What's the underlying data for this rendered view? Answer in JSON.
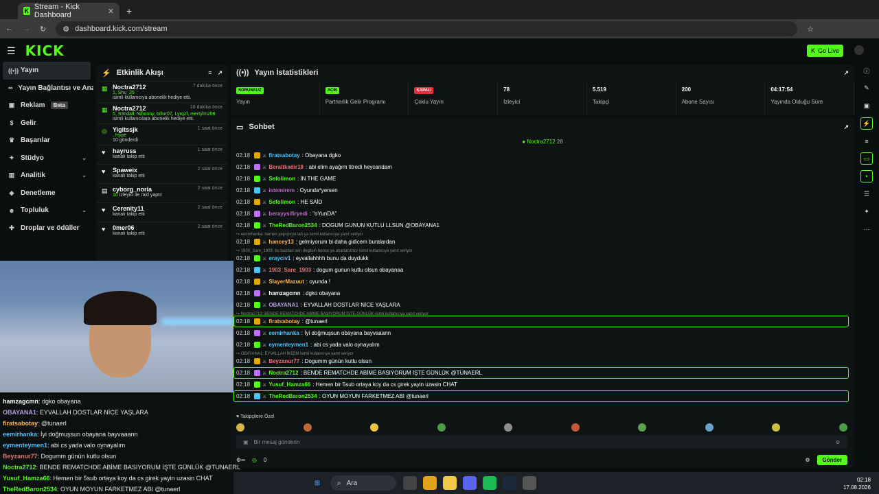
{
  "browser": {
    "tab_title": "Stream - Kick Dashboard",
    "url": "dashboard.kick.com/stream"
  },
  "header": {
    "logo": "KICK",
    "go_live": "Go Live"
  },
  "nav": [
    {
      "label": "Yayın",
      "icon": "broadcast-icon",
      "active": true
    },
    {
      "label": "Yayın Bağlantısı ve Anahtarı",
      "icon": "link-icon"
    },
    {
      "label": "Reklam",
      "icon": "ad-icon",
      "badge": "Beta"
    },
    {
      "label": "Gelir",
      "icon": "money-icon"
    },
    {
      "label": "Başarılar",
      "icon": "trophy-icon"
    },
    {
      "label": "Stüdyo",
      "icon": "studio-icon",
      "chevron": true
    },
    {
      "label": "Analitik",
      "icon": "chart-icon",
      "chevron": true
    },
    {
      "label": "Denetleme",
      "icon": "shield-icon"
    },
    {
      "label": "Topluluk",
      "icon": "users-icon",
      "chevron": true
    },
    {
      "label": "Droplar ve ödüller",
      "icon": "gift-icon"
    }
  ],
  "activity": {
    "title": "Etkinlik Akışı",
    "items": [
      {
        "user": "Noctra2712",
        "time": "7 dakika önce",
        "l1": "1, Shu_25",
        "l2": " isimli kullanıcıya abonelik hediye etti.",
        "kind": "gift"
      },
      {
        "user": "Noctra2712",
        "time": "16 dakika önce",
        "l1": "5, S3ndall, Nihonny, billur07, Lyrqzf, mertylmz08",
        "l2": "isimli kullanıcılara abonelik hediye etti.",
        "kind": "gift"
      },
      {
        "user": "Yigitssjk",
        "time": "1 saat önce",
        "l1": ", Hype",
        "l2": "10 gönderdi",
        "kind": "kicks"
      },
      {
        "user": "hayruss",
        "time": "1 saat önce",
        "l1": "",
        "l2": "kanalı takip etti",
        "kind": "follow"
      },
      {
        "user": "Spaweix",
        "time": "2 saat önce",
        "l1": "",
        "l2": "kanalı takip etti",
        "kind": "follow"
      },
      {
        "user": "cyborg_noria",
        "time": "2 saat önce",
        "l1": "10",
        "l2": " izleyici ile raid yaptı!",
        "kind": "raid"
      },
      {
        "user": "Cerenity11",
        "time": "2 saat önce",
        "l1": "",
        "l2": "kanalı takip etti",
        "kind": "follow"
      },
      {
        "user": "0mer06",
        "time": "2 saat önce",
        "l1": "",
        "l2": "kanalı takip etti",
        "kind": "follow"
      }
    ]
  },
  "stats": {
    "title": "Yayın İstatistikleri",
    "items": [
      {
        "badge": "SORUNSUZ",
        "badge_color": "#53fc18",
        "label": "Yayın"
      },
      {
        "badge": "AÇIK",
        "badge_color": "#53fc18",
        "label": "Partnerlik Gelir Programı"
      },
      {
        "badge": "KAPALI",
        "badge_color": "#e0303a",
        "label": "Çoklu Yayın"
      },
      {
        "value": "78",
        "label": "İzleyici"
      },
      {
        "value": "5.519",
        "label": "Takipçi"
      },
      {
        "value": "200",
        "label": "Abone Sayısı"
      },
      {
        "value": "04:17:54",
        "label": "Yayında Olduğu Süre"
      }
    ]
  },
  "chat": {
    "title": "Sohbet",
    "pinned_user": "Noctra2712",
    "pinned_count": "28",
    "messages": [
      {
        "time": "02:18",
        "user": "firatsabotay",
        "color": "#4fc3f7",
        "text": ": Obayana dgko"
      },
      {
        "time": "02:18",
        "user": "Beraltkadir18",
        "color": "#e57373",
        "text": ": abi elim ayağım titredi heycandam"
      },
      {
        "time": "02:18",
        "user": "Sefolimon",
        "color": "#53fc18",
        "text": ": İN THE GAME"
      },
      {
        "time": "02:18",
        "user": "istemirem",
        "color": "#ba68c8",
        "text": ": Oyunda*yersen"
      },
      {
        "time": "02:18",
        "user": "Sefolimon",
        "color": "#53fc18",
        "text": ": HE SAİD"
      },
      {
        "time": "02:18",
        "user": "berayysifiryedi",
        "color": "#ba68c8",
        "text": ": \"oYunDA\""
      },
      {
        "time": "02:18",
        "user": "TheRedBaron2534",
        "color": "#53fc18",
        "text": ": DOGUM GUNUN KUTLU LLSUN @OBAYANA1"
      },
      {
        "reply": "eemirhanka: hemen yapıştıryo lafı ya isimli kullanıcıya yanıt veriyor"
      },
      {
        "time": "02:18",
        "user": "hancey13",
        "color": "#ffb74d",
        "text": ": gelmiyorum bi daha gidicem buralardan"
      },
      {
        "reply": "1903_Sare_1903: bu bazılari sen degilsin bence ya ahahahzhzv isimli kullanıcıya yanıt veriyor"
      },
      {
        "time": "02:18",
        "user": "erayciv1",
        "color": "#4fc3f7",
        "text": ": eyvallahhhh bunu da duydukk"
      },
      {
        "time": "02:18",
        "user": "1903_Sare_1903",
        "color": "#e57373",
        "text": ": dogum gunun kutlu olsun obayanaa"
      },
      {
        "time": "02:18",
        "user": "SlayerMazuut",
        "color": "#ffb74d",
        "text": ": oyunda !"
      },
      {
        "time": "02:18",
        "user": "hamzagcmn",
        "color": "#ffffff",
        "text": ": dgko obayana"
      },
      {
        "time": "02:18",
        "user": "OBAYANA1",
        "color": "#b39ddb",
        "text": ": EYVALLAH DOSTLAR NİCE YAŞLARA"
      },
      {
        "reply": "Noctra2712: BENDE REMATCHDE ABİME BASIYORUM İŞTE GÜNLÜK isimli kullanıcıya yanıt veriyor"
      },
      {
        "time": "02:18",
        "user": "firatsabotay",
        "color": "#ffb74d",
        "text": ": @tunaerl"
      },
      {
        "time": "02:18",
        "user": "eemirhanka",
        "color": "#4fc3f7",
        "text": ": İyi doğmuşsun obayana bayvaaann"
      },
      {
        "time": "02:18",
        "user": "eymenteymen1",
        "color": "#4fc3f7",
        "text": ": abi cs yada valo oynayalım"
      },
      {
        "reply": "OBAYANA1: EYVALLAH İKİZİM isimli kullanıcıya yanıt veriyor"
      },
      {
        "time": "02:18",
        "user": "Beyzanur77",
        "color": "#e57373",
        "text": ": Dogumm günün kutlu olsun"
      },
      {
        "time": "02:18",
        "user": "Noctra2712",
        "color": "#53fc18",
        "text": ": BENDE REMATCHDE ABİME BASIYORUM İŞTE GÜNLÜK @TUNAERL"
      },
      {
        "time": "02:18",
        "user": "Yusuf_Hamza66",
        "color": "#53fc18",
        "text": ": Hemen bir 5sub ortaya koy da cs girek yayin uzasin CHAT"
      },
      {
        "time": "02:18",
        "user": "TheRedBaron2534",
        "color": "#53fc18",
        "text": ": OYUN MOYUN FARKETMEZ ABI @tunaerl"
      }
    ],
    "followers_only": "Takipçilere Özel",
    "placeholder": "Bir mesaj gönderin",
    "count": "0",
    "send": "Gönder"
  },
  "overlay": [
    {
      "user": "hamzagcmn",
      "color": "#ffffff",
      "text": ": dgko obayana"
    },
    {
      "user": "OBAYANA1",
      "color": "#b39ddb",
      "text": ": EYVALLAH DOSTLAR NİCE YAŞLARA"
    },
    {
      "user": "firatsabotay",
      "color": "#ffb74d",
      "text": ": @tunaerl"
    },
    {
      "user": "eemirhanka",
      "color": "#4fc3f7",
      "text": ": İyi doğmuşsun obayana bayvaaann"
    },
    {
      "user": "eymenteymen1",
      "color": "#4fc3f7",
      "text": ": abi cs yada valo oynayalım"
    },
    {
      "user": "Beyzanur77",
      "color": "#e57373",
      "text": ": Dogumm günün kutlu olsun"
    },
    {
      "user": "Noctra2712",
      "color": "#53fc18",
      "text": ": BENDE REMATCHDE ABİME BASIYORUM İŞTE GÜNLÜK @TUNAERL"
    },
    {
      "user": "Yusuf_Hamza66",
      "color": "#53fc18",
      "text": ": Hemen bir 5sub ortaya koy da cs girek yayin uzasin CHAT"
    },
    {
      "user": "TheRedBaron2534",
      "color": "#53fc18",
      "text": ": OYUN MOYUN FARKETMEZ ABI @tunaerl"
    }
  ],
  "taskbar": {
    "search": "Ara",
    "time": "02:18",
    "date": "17.08.2026"
  }
}
